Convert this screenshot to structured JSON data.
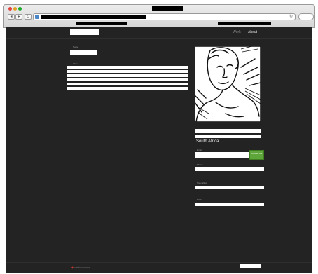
{
  "browser": {
    "back_glyph": "◂",
    "forward_glyph": "▸",
    "reload_glyph": "↻",
    "url_go_glyph": "↻"
  },
  "header": {
    "nav_work": "Work",
    "nav_about": "About"
  },
  "profile": {
    "name_label": "Name",
    "about_label": "About",
    "location": "South Africa",
    "email_label": "Email",
    "email_button": "Contact Me",
    "phone_label": "Phone",
    "specialties_label": "Specialties",
    "skills_label": "Skills"
  },
  "footer": {
    "logo_mark": "◆",
    "logo_text": "carbonmade"
  },
  "colors": {
    "page_background": "#232323",
    "accent_green": "#5ea63a",
    "nav_active": "#e0e0e0",
    "nav_inactive": "#8a8a8a"
  },
  "icons": [
    "back-arrow-icon",
    "forward-arrow-icon",
    "reload-icon",
    "site-favicon-icon"
  ]
}
